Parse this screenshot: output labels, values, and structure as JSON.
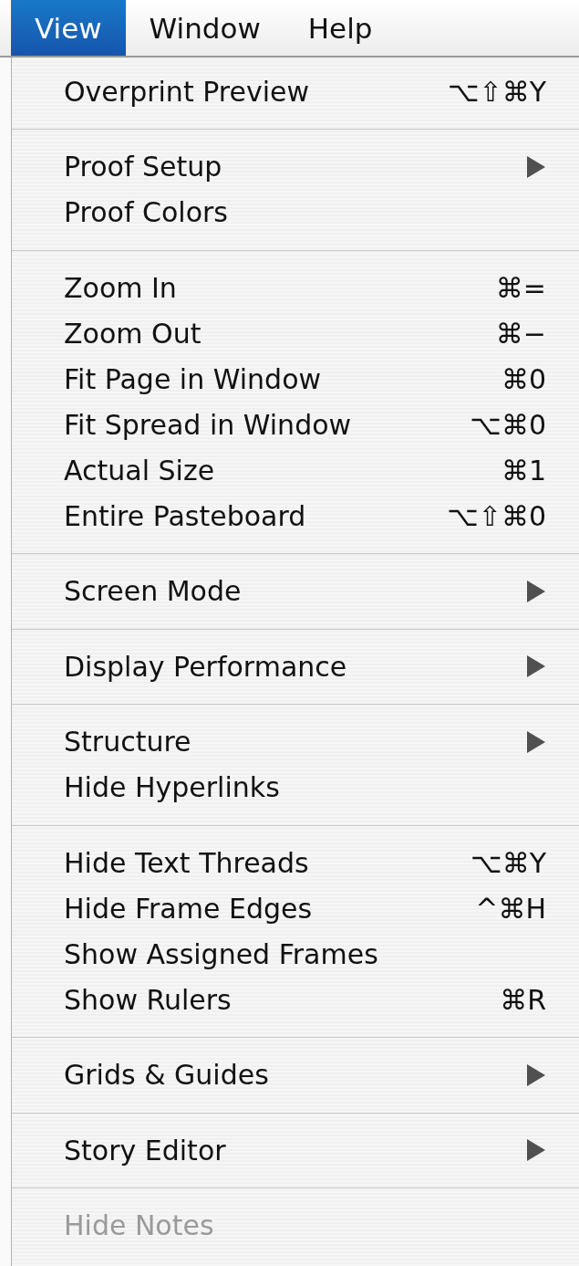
{
  "menubar": [
    {
      "label": "View",
      "selected": true
    },
    {
      "label": "Window",
      "selected": false
    },
    {
      "label": "Help",
      "selected": false
    }
  ],
  "menu": {
    "groups": [
      {
        "items": [
          {
            "label": "Overprint Preview",
            "shortcut": "⌥⇧⌘Y",
            "submenu": false,
            "disabled": false
          }
        ]
      },
      {
        "items": [
          {
            "label": "Proof Setup",
            "submenu": true,
            "disabled": false
          },
          {
            "label": "Proof Colors",
            "submenu": false,
            "disabled": false
          }
        ]
      },
      {
        "items": [
          {
            "label": "Zoom In",
            "shortcut": "⌘=",
            "submenu": false,
            "disabled": false
          },
          {
            "label": "Zoom Out",
            "shortcut": "⌘−",
            "submenu": false,
            "disabled": false
          },
          {
            "label": "Fit Page in Window",
            "shortcut": "⌘0",
            "submenu": false,
            "disabled": false
          },
          {
            "label": "Fit Spread in Window",
            "shortcut": "⌥⌘0",
            "submenu": false,
            "disabled": false
          },
          {
            "label": "Actual Size",
            "shortcut": "⌘1",
            "submenu": false,
            "disabled": false
          },
          {
            "label": "Entire Pasteboard",
            "shortcut": "⌥⇧⌘0",
            "submenu": false,
            "disabled": false
          }
        ]
      },
      {
        "items": [
          {
            "label": "Screen Mode",
            "submenu": true,
            "disabled": false
          }
        ]
      },
      {
        "items": [
          {
            "label": "Display Performance",
            "submenu": true,
            "disabled": false
          }
        ]
      },
      {
        "items": [
          {
            "label": "Structure",
            "submenu": true,
            "disabled": false
          },
          {
            "label": "Hide Hyperlinks",
            "submenu": false,
            "disabled": false
          }
        ]
      },
      {
        "items": [
          {
            "label": "Hide Text Threads",
            "shortcut": "⌥⌘Y",
            "submenu": false,
            "disabled": false
          },
          {
            "label": "Hide Frame Edges",
            "shortcut": "^⌘H",
            "submenu": false,
            "disabled": false
          },
          {
            "label": "Show Assigned Frames",
            "submenu": false,
            "disabled": false
          },
          {
            "label": "Show Rulers",
            "shortcut": "⌘R",
            "submenu": false,
            "disabled": false
          }
        ]
      },
      {
        "items": [
          {
            "label": "Grids & Guides",
            "submenu": true,
            "disabled": false
          }
        ]
      },
      {
        "items": [
          {
            "label": "Story Editor",
            "submenu": true,
            "disabled": false
          }
        ]
      },
      {
        "items": [
          {
            "label": "Hide Notes",
            "submenu": false,
            "disabled": true
          }
        ]
      }
    ]
  }
}
